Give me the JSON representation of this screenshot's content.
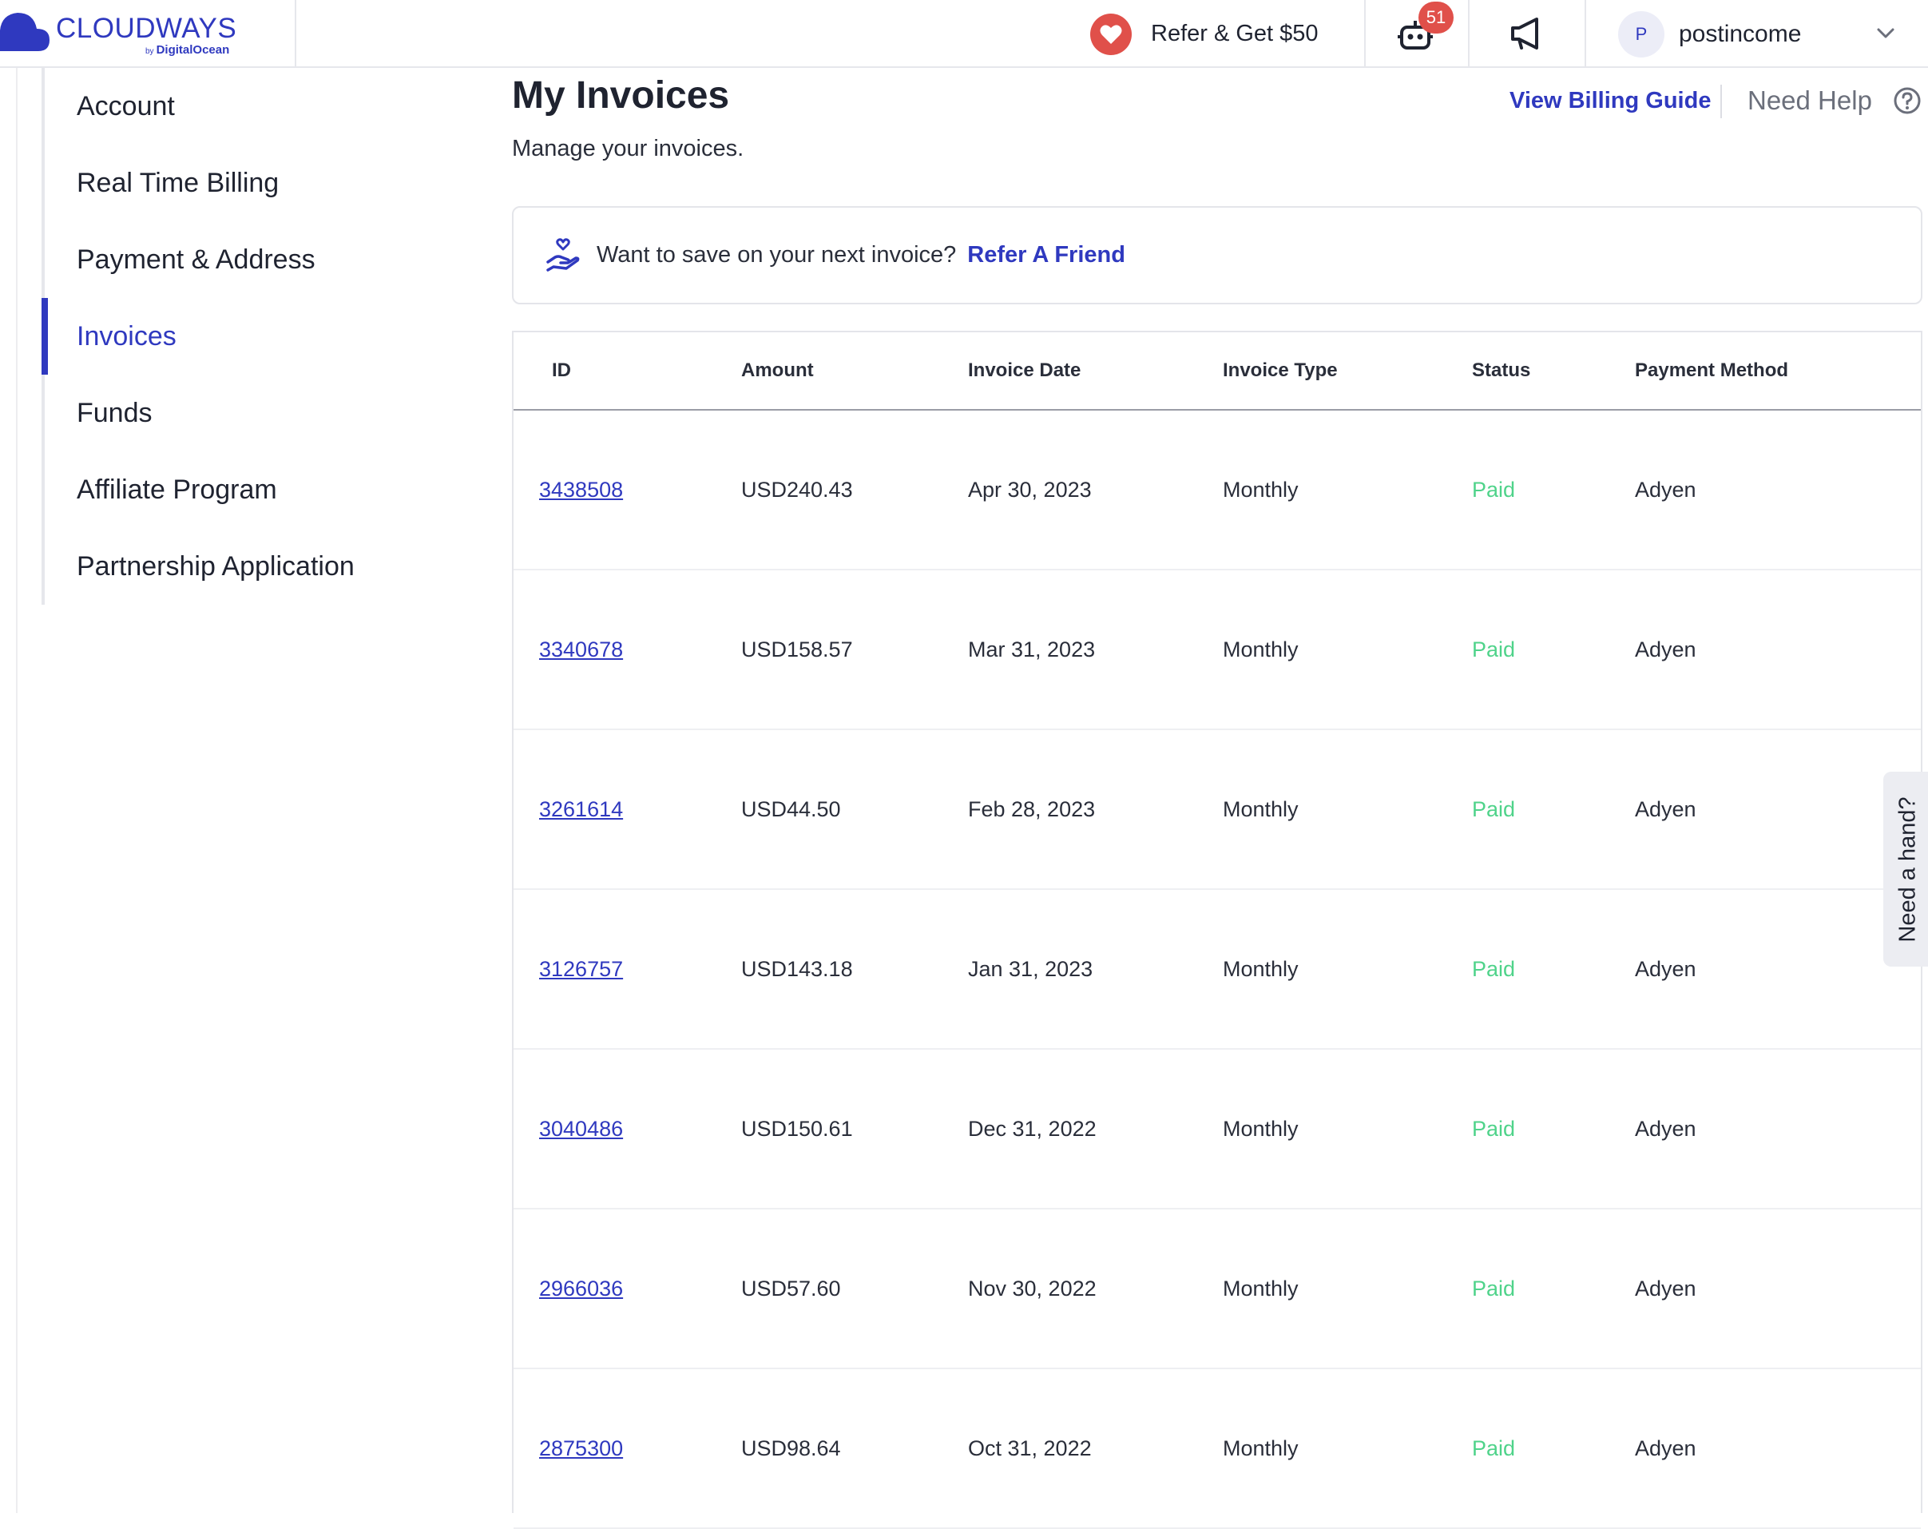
{
  "header": {
    "logo_text": "CLOUDWAYS",
    "logo_by": "by",
    "logo_sub": "DigitalOcean",
    "refer_label": "Refer & Get $50",
    "bot_badge_count": "51",
    "icons": [
      "heart-icon",
      "bot-icon",
      "megaphone-icon",
      "chevron-down-icon"
    ],
    "user": {
      "avatar_initial": "P",
      "name": "postincome"
    }
  },
  "sidebar": {
    "items": [
      {
        "label": "Account",
        "active": false
      },
      {
        "label": "Real Time Billing",
        "active": false
      },
      {
        "label": "Payment & Address",
        "active": false
      },
      {
        "label": "Invoices",
        "active": true
      },
      {
        "label": "Funds",
        "active": false
      },
      {
        "label": "Affiliate Program",
        "active": false
      },
      {
        "label": "Partnership Application",
        "active": false
      }
    ]
  },
  "main": {
    "title": "My Invoices",
    "subtitle": "Manage your invoices.",
    "billing_guide_label": "View Billing Guide",
    "need_help_label": "Need Help",
    "referral_text": "Want to save on your next invoice?",
    "referral_link": "Refer A Friend"
  },
  "table": {
    "columns": [
      "ID",
      "Amount",
      "Invoice Date",
      "Invoice Type",
      "Status",
      "Payment Method"
    ],
    "rows": [
      {
        "id": "3438508",
        "amount": "USD240.43",
        "date": "Apr 30, 2023",
        "type": "Monthly",
        "status": "Paid",
        "method": "Adyen"
      },
      {
        "id": "3340678",
        "amount": "USD158.57",
        "date": "Mar 31, 2023",
        "type": "Monthly",
        "status": "Paid",
        "method": "Adyen"
      },
      {
        "id": "3261614",
        "amount": "USD44.50",
        "date": "Feb 28, 2023",
        "type": "Monthly",
        "status": "Paid",
        "method": "Adyen"
      },
      {
        "id": "3126757",
        "amount": "USD143.18",
        "date": "Jan 31, 2023",
        "type": "Monthly",
        "status": "Paid",
        "method": "Adyen"
      },
      {
        "id": "3040486",
        "amount": "USD150.61",
        "date": "Dec 31, 2022",
        "type": "Monthly",
        "status": "Paid",
        "method": "Adyen"
      },
      {
        "id": "2966036",
        "amount": "USD57.60",
        "date": "Nov 30, 2022",
        "type": "Monthly",
        "status": "Paid",
        "method": "Adyen"
      },
      {
        "id": "2875300",
        "amount": "USD98.64",
        "date": "Oct 31, 2022",
        "type": "Monthly",
        "status": "Paid",
        "method": "Adyen"
      }
    ]
  },
  "side_tab": {
    "label": "Need a hand?"
  },
  "colors": {
    "brand": "#2f39bf",
    "paid": "#4fd38a",
    "badge": "#e0504a"
  }
}
